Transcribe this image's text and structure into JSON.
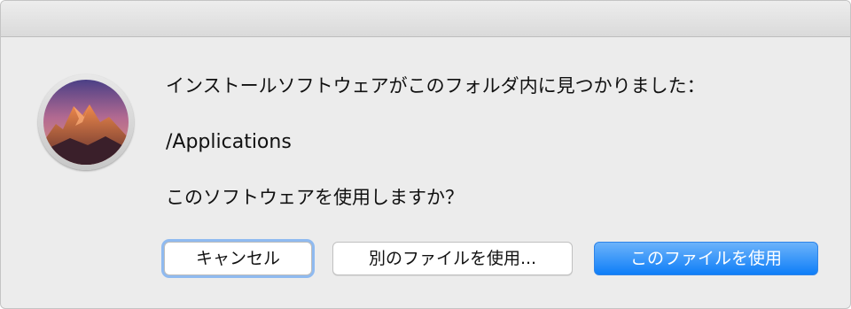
{
  "dialog": {
    "icon": "macos-sierra-installer-icon",
    "message_found": "インストールソフトウェアがこのフォルダ内に見つかりました：",
    "path": "/Applications",
    "question": "このソフトウェアを使用しますか？"
  },
  "buttons": {
    "cancel": "キャンセル",
    "use_other": "別のファイルを使用...",
    "use_this": "このファイルを使用"
  },
  "colors": {
    "dialog_background": "#ececec",
    "default_button": "#1a87f9",
    "focus_ring": "#8fbaf0"
  }
}
